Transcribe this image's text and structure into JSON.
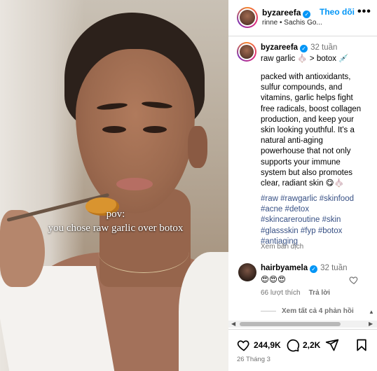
{
  "post": {
    "caption_lines": [
      "pov:",
      "you chose raw garlic over botox"
    ]
  },
  "header": {
    "username": "byzareefa",
    "follow_label": "Theo dõi",
    "more_label": "•••",
    "subtitle": "rinne • Sachis Go..."
  },
  "caption": {
    "username": "byzareefa",
    "time": "32 tuần",
    "title": "raw garlic 🧄 > botox 💉",
    "description": "packed with antioxidants, sulfur compounds, and vitamins, garlic helps fight free radicals, boost collagen production, and keep your skin looking youthful. It's a natural anti-aging powerhouse that not only supports your immune system but also promotes clear, radiant skin 😋🧄",
    "hashtags": [
      "#raw",
      "#rawgarlic",
      "#skinfood",
      "#acne",
      "#detox",
      "#skincareroutine",
      "#skin",
      "#glassskin",
      "#fyp",
      "#botox",
      "#antiaging"
    ],
    "translate_label": "Xem bản dịch"
  },
  "comment": {
    "username": "hairbyamela",
    "time": "32 tuần",
    "text": "😍😍😍",
    "likes": "66 lượt thích",
    "reply_label": "Trả lời",
    "view_replies": "Xem tất cả 4 phản hồi"
  },
  "actions": {
    "likes": "244,9K",
    "comments": "2,2K"
  },
  "date": "26 Tháng 3",
  "colors": {
    "accent": "#0095f6",
    "hashtag": "#385185",
    "muted": "#737373"
  }
}
